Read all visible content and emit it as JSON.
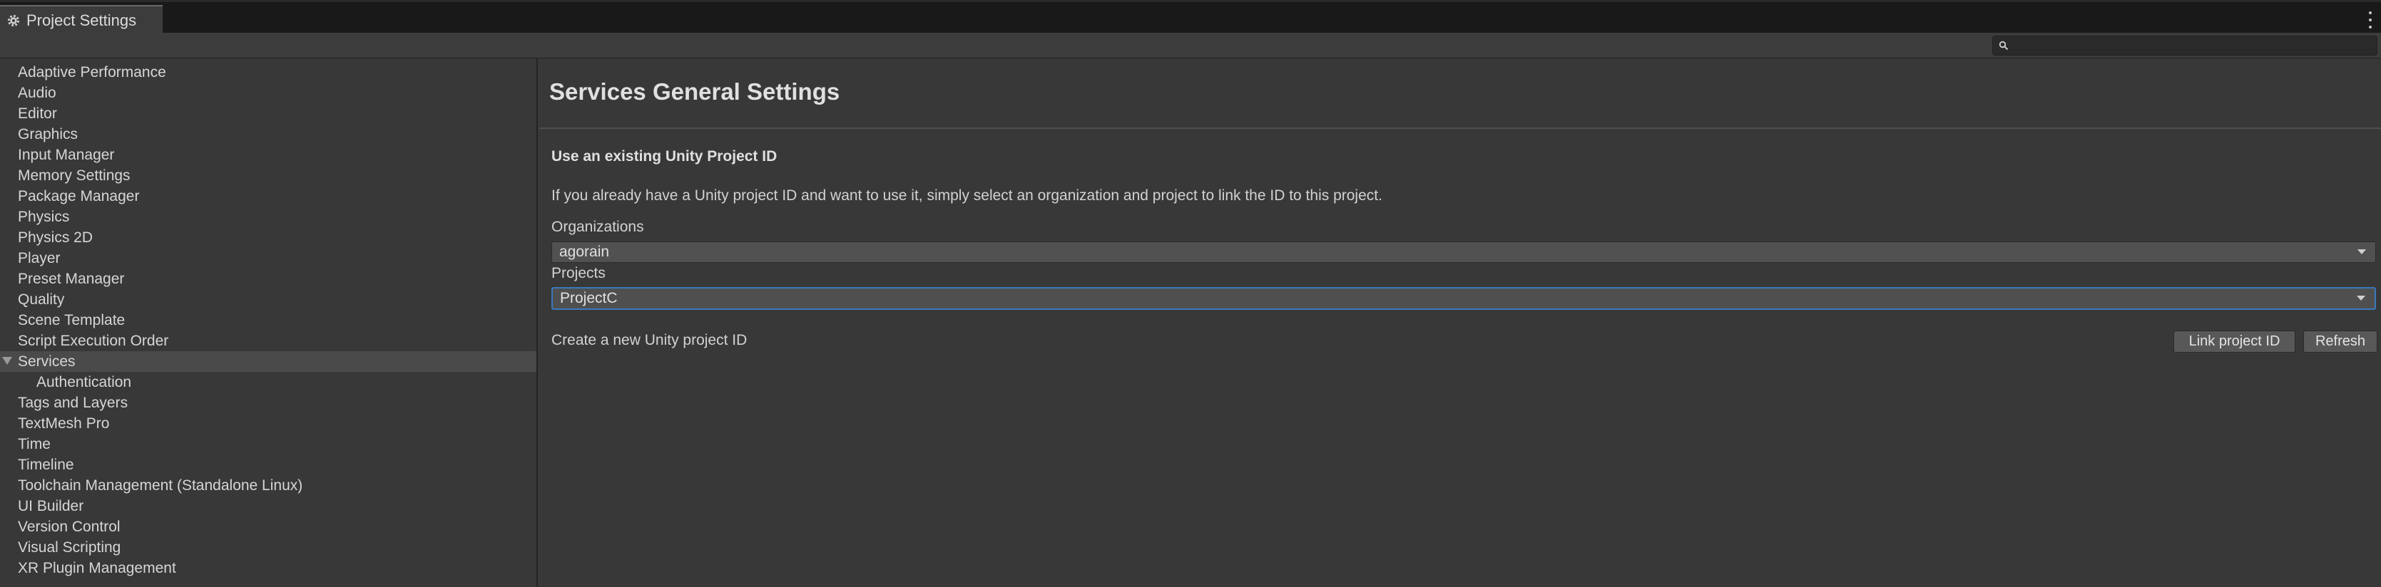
{
  "window": {
    "tab_title": "Project Settings",
    "tab_icon": "gear-icon",
    "menu_icon": "kebab-menu-icon"
  },
  "search": {
    "icon": "search-icon",
    "value": "",
    "placeholder": ""
  },
  "sidebar": {
    "items": [
      {
        "label": "Adaptive Performance"
      },
      {
        "label": "Audio"
      },
      {
        "label": "Editor"
      },
      {
        "label": "Graphics"
      },
      {
        "label": "Input Manager"
      },
      {
        "label": "Memory Settings"
      },
      {
        "label": "Package Manager"
      },
      {
        "label": "Physics"
      },
      {
        "label": "Physics 2D"
      },
      {
        "label": "Player"
      },
      {
        "label": "Preset Manager"
      },
      {
        "label": "Quality"
      },
      {
        "label": "Scene Template"
      },
      {
        "label": "Script Execution Order"
      },
      {
        "label": "Services",
        "selected": true,
        "expanded": true
      },
      {
        "label": "Authentication",
        "child": true
      },
      {
        "label": "Tags and Layers"
      },
      {
        "label": "TextMesh Pro"
      },
      {
        "label": "Time"
      },
      {
        "label": "Timeline"
      },
      {
        "label": "Toolchain Management (Standalone Linux)"
      },
      {
        "label": "UI Builder"
      },
      {
        "label": "Version Control"
      },
      {
        "label": "Visual Scripting"
      },
      {
        "label": "XR Plugin Management"
      }
    ]
  },
  "main": {
    "title": "Services General Settings",
    "section_heading": "Use an existing Unity Project ID",
    "description": "If you already have a Unity project ID and want to use it, simply select an organization and project to link the ID to this project.",
    "organizations": {
      "label": "Organizations",
      "value": "agorain"
    },
    "projects": {
      "label": "Projects",
      "value": "ProjectC"
    },
    "create_label": "Create a new Unity project ID",
    "link_button": "Link project ID",
    "refresh_button": "Refresh"
  },
  "colors": {
    "background": "#383838",
    "titlebar": "#191919",
    "selected_row": "#4a4a4a",
    "focus_border": "#3a79bb"
  }
}
